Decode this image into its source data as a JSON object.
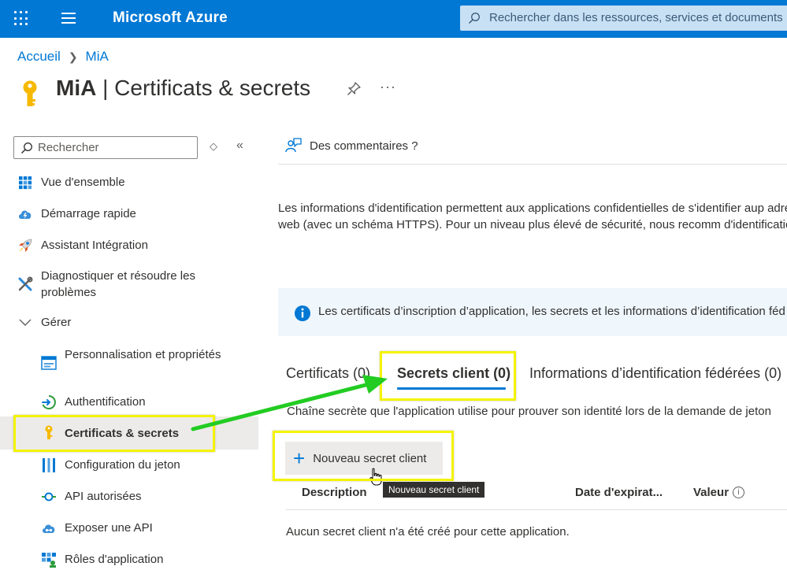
{
  "topbar": {
    "brand": "Microsoft Azure",
    "search_placeholder": "Rechercher dans les ressources, services et documents"
  },
  "breadcrumb": {
    "home": "Accueil",
    "current": "MiA"
  },
  "title": {
    "app_name": "MiA",
    "page": "Certificats & secrets"
  },
  "sidebar": {
    "search_placeholder": "Rechercher",
    "items": [
      {
        "label": "Vue d'ensemble",
        "icon": "overview-grid-icon"
      },
      {
        "label": "Démarrage rapide",
        "icon": "cloud-lightning-icon"
      },
      {
        "label": "Assistant Intégration",
        "icon": "rocket-icon"
      },
      {
        "label": "Diagnostiquer et résoudre les problèmes",
        "icon": "wrench-icon"
      },
      {
        "label": "Gérer",
        "icon": "chevron-down-icon"
      },
      {
        "label": "Personnalisation et propriétés",
        "icon": "branding-icon"
      },
      {
        "label": "Authentification",
        "icon": "authentication-icon"
      },
      {
        "label": "Certificats & secrets",
        "icon": "key-icon"
      },
      {
        "label": "Configuration du jeton",
        "icon": "token-bars-icon"
      },
      {
        "label": "API autorisées",
        "icon": "api-permissions-icon"
      },
      {
        "label": "Exposer une API",
        "icon": "cloud-api-icon"
      },
      {
        "label": "Rôles d'application",
        "icon": "app-roles-icon"
      }
    ]
  },
  "main": {
    "feedback": "Des commentaires ?",
    "description": "Les informations d'identification permettent aux applications confidentielles de s'identifier aup adressable web (avec un schéma HTTPS). Pour un niveau plus élevé de sécurité, nous recomm d'identification.",
    "info_banner": "Les certificats d’inscription d’application, les secrets et les informations d’identification féd",
    "tabs": [
      {
        "label": "Certificats (0)"
      },
      {
        "label": "Secrets client (0)"
      },
      {
        "label": "Informations d’identification fédérées (0)"
      }
    ],
    "tab_description": "Chaîne secrète que l'application utilise pour prouver son identité lors de la demande de jeton",
    "new_secret_button": "Nouveau secret client",
    "tooltip": "Nouveau secret client",
    "table": {
      "columns": [
        "Description",
        "Date d'expirat...",
        "Valeur"
      ],
      "empty_message": "Aucun secret client n'a été créé pour cette application."
    }
  },
  "colors": {
    "accent": "#0078d4",
    "highlight": "#f4f400",
    "arrow": "#22cc22"
  }
}
